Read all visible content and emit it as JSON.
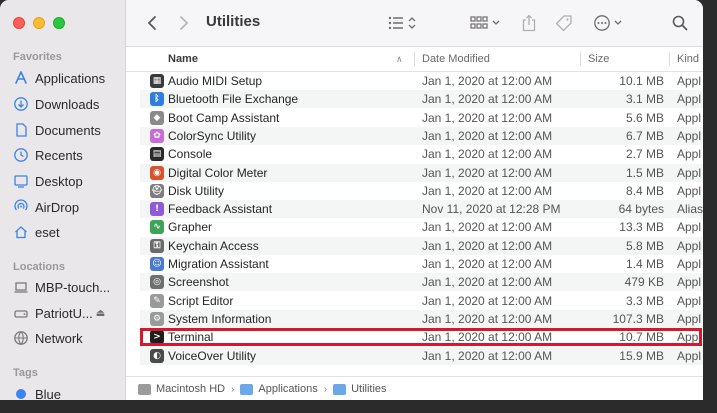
{
  "window": {
    "title": "Utilities"
  },
  "sidebar": {
    "favorites_label": "Favorites",
    "favorites": [
      {
        "label": "Applications",
        "icon": "applications-icon"
      },
      {
        "label": "Downloads",
        "icon": "downloads-icon"
      },
      {
        "label": "Documents",
        "icon": "documents-icon"
      },
      {
        "label": "Recents",
        "icon": "recents-icon"
      },
      {
        "label": "Desktop",
        "icon": "desktop-icon"
      },
      {
        "label": "AirDrop",
        "icon": "airdrop-icon"
      },
      {
        "label": "eset",
        "icon": "home-icon"
      }
    ],
    "locations_label": "Locations",
    "locations": [
      {
        "label": "MBP-touch...",
        "icon": "laptop-icon"
      },
      {
        "label": "PatriotU...",
        "icon": "drive-icon",
        "eject": "⏏"
      },
      {
        "label": "Network",
        "icon": "network-icon"
      }
    ],
    "tags_label": "Tags",
    "tags": [
      {
        "label": "Blue",
        "color": "#3b82f6"
      }
    ]
  },
  "columns": {
    "name": "Name",
    "date": "Date Modified",
    "size": "Size",
    "kind": "Kind"
  },
  "files": [
    {
      "name": "Audio MIDI Setup",
      "date": "Jan 1, 2020 at 12:00 AM",
      "size": "10.1 MB",
      "kind": "Appl",
      "icon_color": "#3b3b3b",
      "icon_glyph": "▦"
    },
    {
      "name": "Bluetooth File Exchange",
      "date": "Jan 1, 2020 at 12:00 AM",
      "size": "3.1 MB",
      "kind": "Appl",
      "icon_color": "#2f7de1",
      "icon_glyph": "ᛒ"
    },
    {
      "name": "Boot Camp Assistant",
      "date": "Jan 1, 2020 at 12:00 AM",
      "size": "5.6 MB",
      "kind": "Appl",
      "icon_color": "#8a8a8a",
      "icon_glyph": "◆"
    },
    {
      "name": "ColorSync Utility",
      "date": "Jan 1, 2020 at 12:00 AM",
      "size": "6.7 MB",
      "kind": "Appl",
      "icon_color": "#c86dd7",
      "icon_glyph": "✿"
    },
    {
      "name": "Console",
      "date": "Jan 1, 2020 at 12:00 AM",
      "size": "2.7 MB",
      "kind": "Appl",
      "icon_color": "#2a2a2a",
      "icon_glyph": "▤"
    },
    {
      "name": "Digital Color Meter",
      "date": "Jan 1, 2020 at 12:00 AM",
      "size": "1.5 MB",
      "kind": "Appl",
      "icon_color": "#d9532c",
      "icon_glyph": "◉"
    },
    {
      "name": "Disk Utility",
      "date": "Jan 1, 2020 at 12:00 AM",
      "size": "8.4 MB",
      "kind": "Appl",
      "icon_color": "#7d7d7d",
      "icon_glyph": "⛑"
    },
    {
      "name": "Feedback Assistant",
      "date": "Nov 11, 2020 at 12:28 PM",
      "size": "64 bytes",
      "kind": "Alias",
      "icon_color": "#8e5ad8",
      "icon_glyph": "!"
    },
    {
      "name": "Grapher",
      "date": "Jan 1, 2020 at 12:00 AM",
      "size": "13.3 MB",
      "kind": "Appl",
      "icon_color": "#3fa35a",
      "icon_glyph": "∿"
    },
    {
      "name": "Keychain Access",
      "date": "Jan 1, 2020 at 12:00 AM",
      "size": "5.8 MB",
      "kind": "Appl",
      "icon_color": "#6b6b6b",
      "icon_glyph": "⚿"
    },
    {
      "name": "Migration Assistant",
      "date": "Jan 1, 2020 at 12:00 AM",
      "size": "1.4 MB",
      "kind": "Appl",
      "icon_color": "#4a7bd1",
      "icon_glyph": "☺"
    },
    {
      "name": "Screenshot",
      "date": "Jan 1, 2020 at 12:00 AM",
      "size": "479 KB",
      "kind": "Appl",
      "icon_color": "#6f6f6f",
      "icon_glyph": "◎"
    },
    {
      "name": "Script Editor",
      "date": "Jan 1, 2020 at 12:00 AM",
      "size": "3.3 MB",
      "kind": "Appl",
      "icon_color": "#9a9a9a",
      "icon_glyph": "✎"
    },
    {
      "name": "System Information",
      "date": "Jan 1, 2020 at 12:00 AM",
      "size": "107.3 MB",
      "kind": "Appl",
      "icon_color": "#9a9a9a",
      "icon_glyph": "⚙"
    },
    {
      "name": "Terminal",
      "date": "Jan 1, 2020 at 12:00 AM",
      "size": "10.7 MB",
      "kind": "Appl",
      "icon_color": "#1e1e1e",
      "icon_glyph": ">",
      "highlighted": true
    },
    {
      "name": "VoiceOver Utility",
      "date": "Jan 1, 2020 at 12:00 AM",
      "size": "15.9 MB",
      "kind": "Appl",
      "icon_color": "#4a4a4a",
      "icon_glyph": "◐"
    }
  ],
  "pathbar": [
    {
      "label": "Macintosh HD",
      "icon_color": "#9b9b9b"
    },
    {
      "label": "Applications",
      "icon_color": "#6aa8e8"
    },
    {
      "label": "Utilities",
      "icon_color": "#6aa8e8"
    }
  ],
  "colors": {
    "highlight": "#d6182a",
    "accent": "#3d83e6"
  }
}
